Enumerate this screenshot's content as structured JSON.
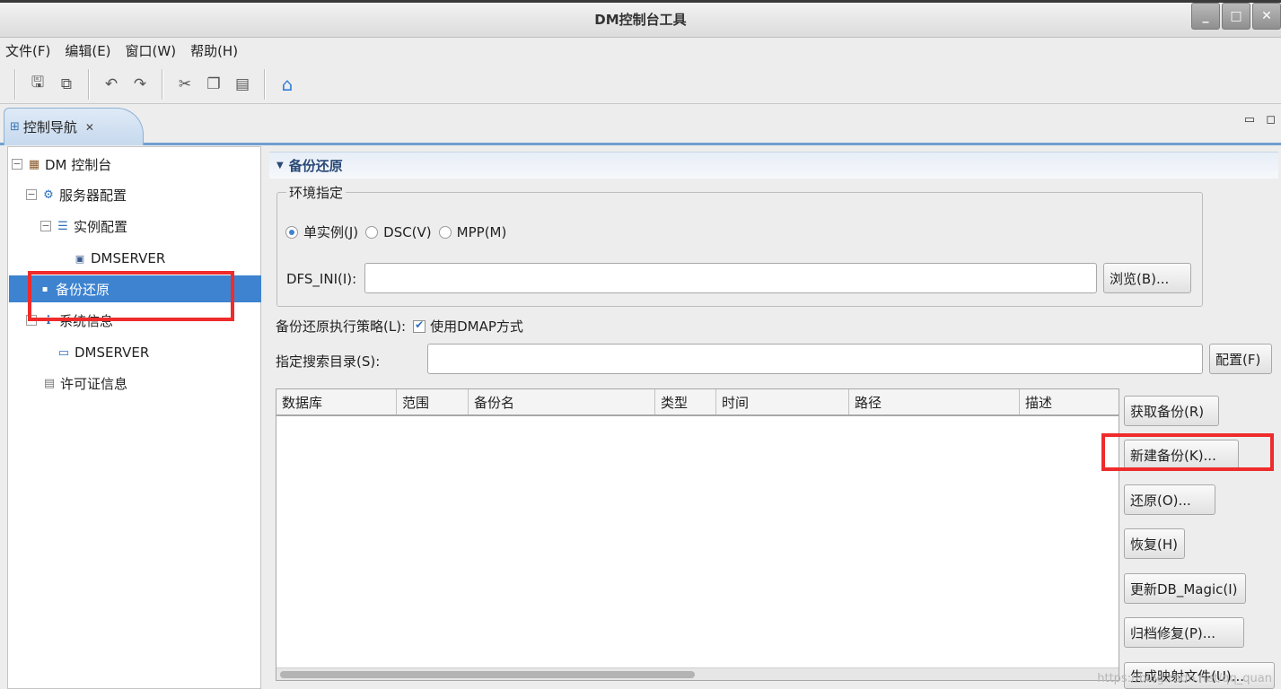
{
  "window": {
    "title": "DM控制台工具",
    "minimize": "_",
    "maximize": "□",
    "close": "✕"
  },
  "menu": [
    "文件(F)",
    "编辑(E)",
    "窗口(W)",
    "帮助(H)"
  ],
  "toolbar": {
    "icons": [
      "save-icon",
      "save-all-icon",
      "undo-icon",
      "redo-icon",
      "cut-icon",
      "copy-icon",
      "paste-icon",
      "home-icon"
    ]
  },
  "tab": {
    "label": "控制导航",
    "close": "✕",
    "view_controls": "▭ ◻"
  },
  "tree": {
    "root": "DM 控制台",
    "server_config": "服务器配置",
    "instance_config": "实例配置",
    "dmserver1": "DMSERVER",
    "backup_restore": "备份还原",
    "system_info": "系统信息",
    "dmserver2": "DMSERVER",
    "license_info": "许可证信息"
  },
  "panel": {
    "title": "备份还原",
    "env_group_label": "环境指定",
    "radio_single": "单实例(J)",
    "radio_dsc": "DSC(V)",
    "radio_mpp": "MPP(M)",
    "dfs_label": "DFS_INI(I):",
    "dfs_value": "",
    "browse_button": "浏览(B)...",
    "strategy_label": "备份还原执行策略(L):",
    "strategy_checkbox": "使用DMAP方式",
    "search_dir_label": "指定搜索目录(S):",
    "search_dir_value": "",
    "config_button": "配置(F)"
  },
  "table": {
    "columns": [
      "数据库",
      "范围",
      "备份名",
      "类型",
      "时间",
      "路径",
      "描述"
    ],
    "rows": []
  },
  "actions": {
    "get_backup": "获取备份(R)",
    "new_backup": "新建备份(K)...",
    "restore": "还原(O)...",
    "recover": "恢复(H)",
    "update_magic": "更新DB_Magic(I)",
    "archive_repair": "归档修复(P)...",
    "gen_map": "生成映射文件(U)..."
  },
  "colors": {
    "highlight_red": "#ef2b2b",
    "selection_blue": "#3d83cf"
  },
  "watermark": "https://blog.csdn.net/qq_quan"
}
